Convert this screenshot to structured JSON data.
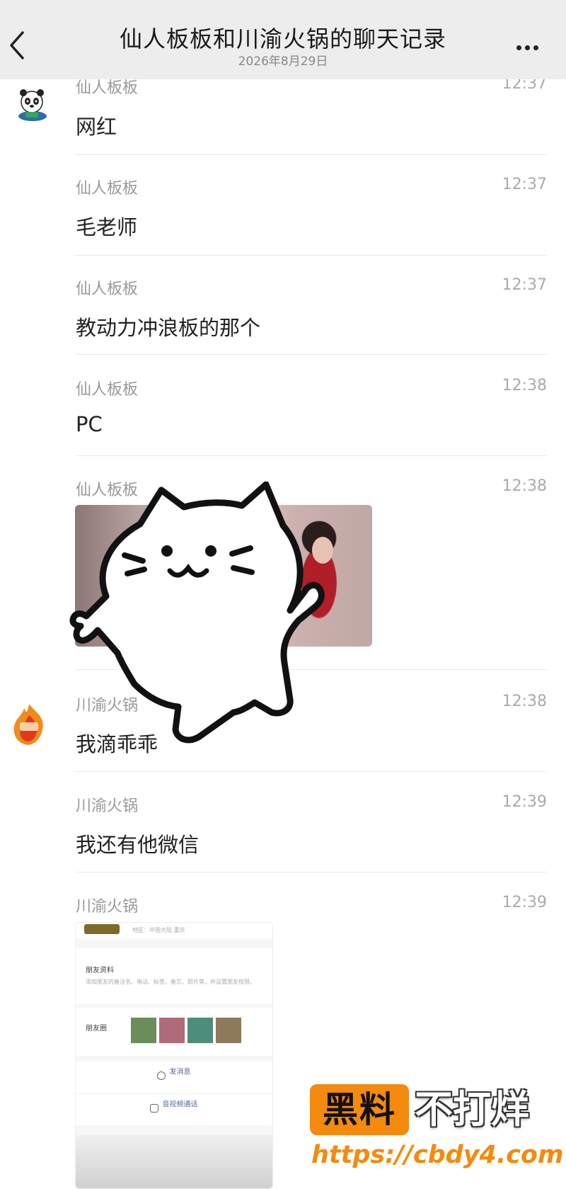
{
  "header": {
    "title": "仙人板板和川渝火锅的聊天记录",
    "date": "2026年8月29日"
  },
  "messages": [
    {
      "sender": "仙人板板",
      "time": "12:37",
      "text": "网红"
    },
    {
      "sender": "仙人板板",
      "time": "12:37",
      "text": "毛老师"
    },
    {
      "sender": "仙人板板",
      "time": "12:37",
      "text": "教动力冲浪板的那个"
    },
    {
      "sender": "仙人板板",
      "time": "12:38",
      "text": "PC"
    },
    {
      "sender": "仙人板板",
      "time": "12:38",
      "text": ""
    },
    {
      "sender": "川渝火锅",
      "time": "12:38",
      "text": "我滴乖乖"
    },
    {
      "sender": "川渝火锅",
      "time": "12:39",
      "text": "我还有他微信"
    },
    {
      "sender": "川渝火锅",
      "time": "12:39",
      "text": ""
    }
  ],
  "profile_screenshot": {
    "region": "地区：中国大陆 重庆",
    "friend_info_label": "朋友资料",
    "friend_info_desc": "添加朋友的备注名、电话、标签、备忘、照片等，并设置朋友权限。",
    "moments_label": "朋友圈",
    "send_message": "发消息",
    "call": "音视频通话"
  },
  "watermark": {
    "brand": "黑料",
    "slogan": "不打烊",
    "url": "https://cbdy4.com"
  },
  "colors": {
    "header_bg": "#ededed",
    "watermark_orange": "#f48a0e"
  }
}
